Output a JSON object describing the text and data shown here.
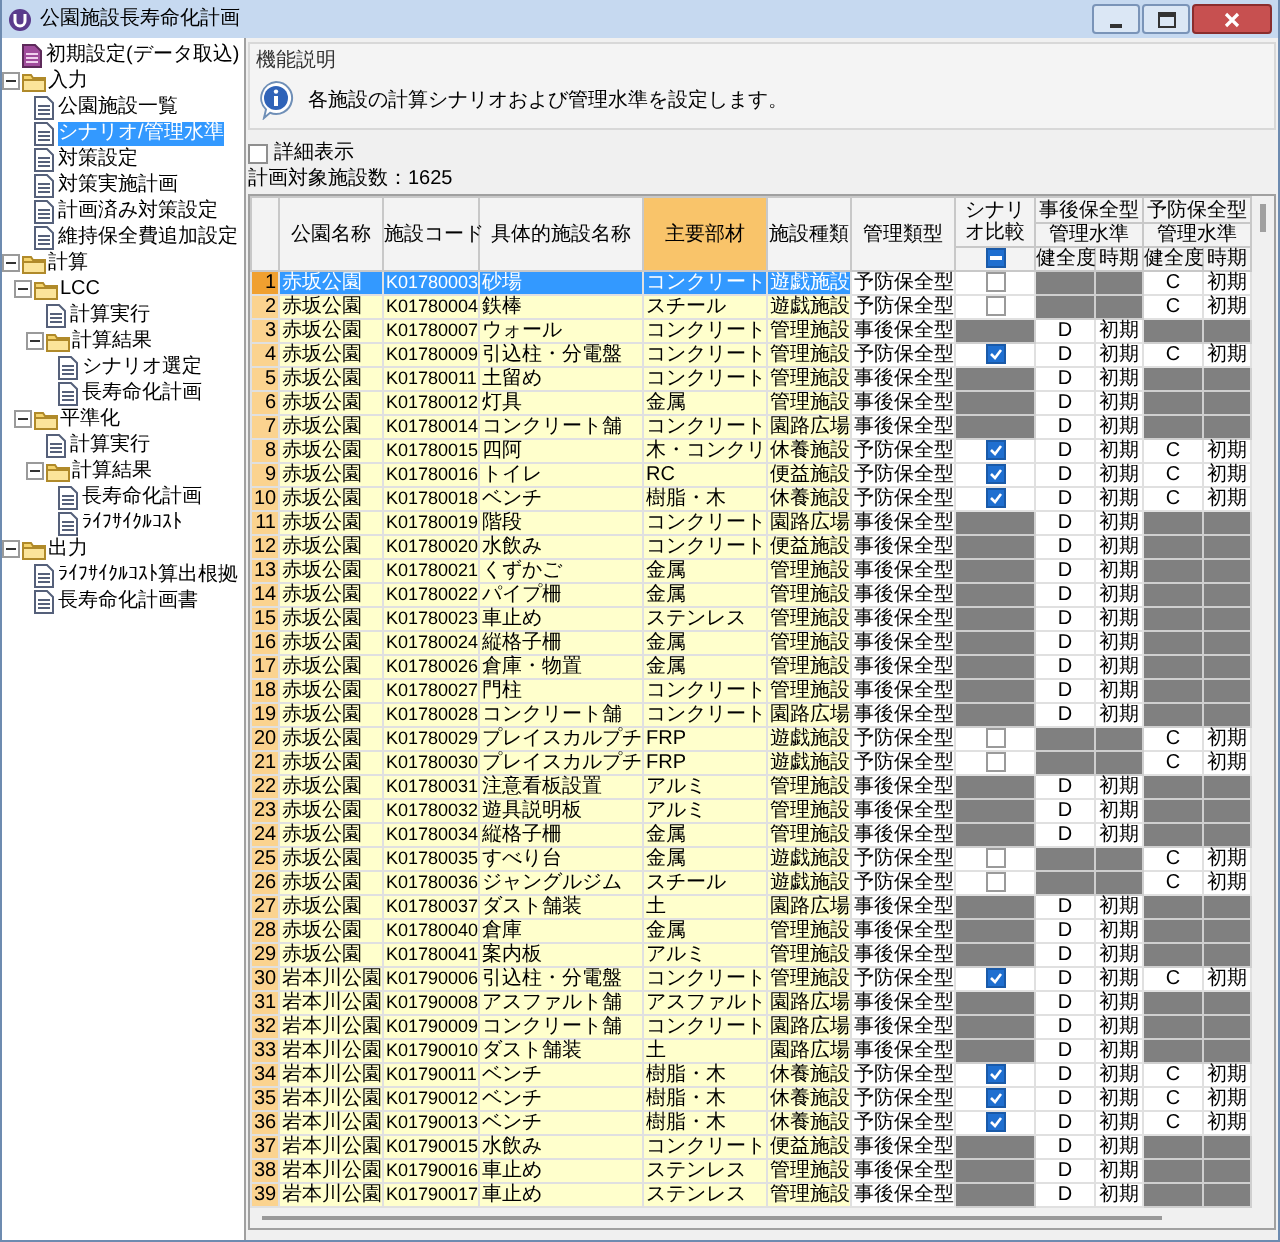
{
  "window": {
    "title": "公園施設長寿命化計画"
  },
  "sidebar": {
    "tree": [
      {
        "label": "初期設定(データ取込)",
        "kind": "special",
        "selected": false
      },
      {
        "label": "入力",
        "kind": "folder",
        "expanded": true,
        "selected": false,
        "children": [
          {
            "label": "公園施設一覧",
            "kind": "doc",
            "selected": false
          },
          {
            "label": "シナリオ/管理水準",
            "kind": "doc",
            "selected": true
          },
          {
            "label": "対策設定",
            "kind": "doc",
            "selected": false
          },
          {
            "label": "対策実施計画",
            "kind": "doc",
            "selected": false
          },
          {
            "label": "計画済み対策設定",
            "kind": "doc",
            "selected": false
          },
          {
            "label": "維持保全費追加設定",
            "kind": "doc",
            "selected": false
          }
        ]
      },
      {
        "label": "計算",
        "kind": "folder",
        "expanded": true,
        "selected": false,
        "children": [
          {
            "label": "LCC",
            "kind": "folder",
            "expanded": true,
            "selected": false,
            "children": [
              {
                "label": "計算実行",
                "kind": "doc",
                "selected": false
              },
              {
                "label": "計算結果",
                "kind": "folder",
                "expanded": true,
                "selected": false,
                "children": [
                  {
                    "label": "シナリオ選定",
                    "kind": "doc",
                    "selected": false
                  },
                  {
                    "label": "長寿命化計画",
                    "kind": "doc",
                    "selected": false
                  }
                ]
              }
            ]
          },
          {
            "label": "平準化",
            "kind": "folder",
            "expanded": true,
            "selected": false,
            "children": [
              {
                "label": "計算実行",
                "kind": "doc",
                "selected": false
              },
              {
                "label": "計算結果",
                "kind": "folder",
                "expanded": true,
                "selected": false,
                "children": [
                  {
                    "label": "長寿命化計画",
                    "kind": "doc",
                    "selected": false
                  },
                  {
                    "label": "ﾗｲﾌｻｲｸﾙｺｽﾄ",
                    "kind": "doc",
                    "selected": false
                  }
                ]
              }
            ]
          }
        ]
      },
      {
        "label": "出力",
        "kind": "folder",
        "expanded": true,
        "selected": false,
        "children": [
          {
            "label": "ﾗｲﾌｻｲｸﾙｺｽﾄ算出根拠",
            "kind": "doc",
            "selected": false
          },
          {
            "label": "長寿命化計画書",
            "kind": "doc",
            "selected": false
          }
        ]
      }
    ]
  },
  "description": {
    "label": "機能説明",
    "text": "各施設の計算シナリオおよび管理水準を設定します。"
  },
  "detail_checkbox": {
    "label": "詳細表示",
    "checked": false
  },
  "count": "計画対象施設数：1625",
  "table": {
    "columns": [
      {
        "label": "公園名称",
        "highlighted": false
      },
      {
        "label": "施設コード",
        "highlighted": false
      },
      {
        "label": "具体的施設名称",
        "highlighted": false
      },
      {
        "label": "主要部材",
        "highlighted": true
      },
      {
        "label": "施設種類",
        "highlighted": false
      },
      {
        "label": "管理類型",
        "highlighted": false
      },
      {
        "label": "シナリオ比較",
        "highlighted": false
      }
    ],
    "groups": [
      {
        "label": "事後保全型",
        "sub": "管理水準",
        "cols": [
          "健全度",
          "時期"
        ]
      },
      {
        "label": "予防保全型",
        "sub": "管理水準",
        "cols": [
          "健全度",
          "時期"
        ]
      }
    ],
    "compare_all": {
      "mixed": true
    },
    "rows": [
      {
        "no": "1",
        "park": "赤坂公園",
        "code": "K01780003",
        "name": "砂場",
        "material": "コンクリート",
        "type": "遊戯施設",
        "mgmt": "予防保全型",
        "selected": true,
        "compare": {
          "checked": false
        },
        "prev": {
          "health": "C",
          "timing": "初期"
        }
      },
      {
        "no": "2",
        "park": "赤坂公園",
        "code": "K01780004",
        "name": "鉄棒",
        "material": "スチール",
        "type": "遊戯施設",
        "mgmt": "予防保全型",
        "selected": false,
        "compare": {
          "checked": false
        },
        "prev": {
          "health": "C",
          "timing": "初期"
        }
      },
      {
        "no": "3",
        "park": "赤坂公園",
        "code": "K01780007",
        "name": "ウォール",
        "material": "コンクリート",
        "type": "管理施設",
        "mgmt": "事後保全型",
        "selected": false,
        "post": {
          "health": "D",
          "timing": "初期"
        }
      },
      {
        "no": "4",
        "park": "赤坂公園",
        "code": "K01780009",
        "name": "引込柱・分電盤",
        "material": "コンクリート",
        "type": "管理施設",
        "mgmt": "予防保全型",
        "selected": false,
        "compare": {
          "checked": true
        },
        "post": {
          "health": "D",
          "timing": "初期"
        },
        "prev": {
          "health": "C",
          "timing": "初期"
        }
      },
      {
        "no": "5",
        "park": "赤坂公園",
        "code": "K01780011",
        "name": "土留め",
        "material": "コンクリート",
        "type": "管理施設",
        "mgmt": "事後保全型",
        "selected": false,
        "post": {
          "health": "D",
          "timing": "初期"
        }
      },
      {
        "no": "6",
        "park": "赤坂公園",
        "code": "K01780012",
        "name": "灯具",
        "material": "金属",
        "type": "管理施設",
        "mgmt": "事後保全型",
        "selected": false,
        "post": {
          "health": "D",
          "timing": "初期"
        }
      },
      {
        "no": "7",
        "park": "赤坂公園",
        "code": "K01780014",
        "name": "コンクリート舗",
        "material": "コンクリート",
        "type": "園路広場",
        "mgmt": "事後保全型",
        "selected": false,
        "post": {
          "health": "D",
          "timing": "初期"
        }
      },
      {
        "no": "8",
        "park": "赤坂公園",
        "code": "K01780015",
        "name": "四阿",
        "material": "木・コンクリ",
        "type": "休養施設",
        "mgmt": "予防保全型",
        "selected": false,
        "compare": {
          "checked": true
        },
        "post": {
          "health": "D",
          "timing": "初期"
        },
        "prev": {
          "health": "C",
          "timing": "初期"
        }
      },
      {
        "no": "9",
        "park": "赤坂公園",
        "code": "K01780016",
        "name": "トイレ",
        "material": "RC",
        "type": "便益施設",
        "mgmt": "予防保全型",
        "selected": false,
        "compare": {
          "checked": true
        },
        "post": {
          "health": "D",
          "timing": "初期"
        },
        "prev": {
          "health": "C",
          "timing": "初期"
        }
      },
      {
        "no": "10",
        "park": "赤坂公園",
        "code": "K01780018",
        "name": "ベンチ",
        "material": "樹脂・木",
        "type": "休養施設",
        "mgmt": "予防保全型",
        "selected": false,
        "compare": {
          "checked": true
        },
        "post": {
          "health": "D",
          "timing": "初期"
        },
        "prev": {
          "health": "C",
          "timing": "初期"
        }
      },
      {
        "no": "11",
        "park": "赤坂公園",
        "code": "K01780019",
        "name": "階段",
        "material": "コンクリート",
        "type": "園路広場",
        "mgmt": "事後保全型",
        "selected": false,
        "post": {
          "health": "D",
          "timing": "初期"
        }
      },
      {
        "no": "12",
        "park": "赤坂公園",
        "code": "K01780020",
        "name": "水飲み",
        "material": "コンクリート",
        "type": "便益施設",
        "mgmt": "事後保全型",
        "selected": false,
        "post": {
          "health": "D",
          "timing": "初期"
        }
      },
      {
        "no": "13",
        "park": "赤坂公園",
        "code": "K01780021",
        "name": "くずかご",
        "material": "金属",
        "type": "管理施設",
        "mgmt": "事後保全型",
        "selected": false,
        "post": {
          "health": "D",
          "timing": "初期"
        }
      },
      {
        "no": "14",
        "park": "赤坂公園",
        "code": "K01780022",
        "name": "パイプ柵",
        "material": "金属",
        "type": "管理施設",
        "mgmt": "事後保全型",
        "selected": false,
        "post": {
          "health": "D",
          "timing": "初期"
        }
      },
      {
        "no": "15",
        "park": "赤坂公園",
        "code": "K01780023",
        "name": "車止め",
        "material": "ステンレス",
        "type": "管理施設",
        "mgmt": "事後保全型",
        "selected": false,
        "post": {
          "health": "D",
          "timing": "初期"
        }
      },
      {
        "no": "16",
        "park": "赤坂公園",
        "code": "K01780024",
        "name": "縦格子柵",
        "material": "金属",
        "type": "管理施設",
        "mgmt": "事後保全型",
        "selected": false,
        "post": {
          "health": "D",
          "timing": "初期"
        }
      },
      {
        "no": "17",
        "park": "赤坂公園",
        "code": "K01780026",
        "name": "倉庫・物置",
        "material": "金属",
        "type": "管理施設",
        "mgmt": "事後保全型",
        "selected": false,
        "post": {
          "health": "D",
          "timing": "初期"
        }
      },
      {
        "no": "18",
        "park": "赤坂公園",
        "code": "K01780027",
        "name": "門柱",
        "material": "コンクリート",
        "type": "管理施設",
        "mgmt": "事後保全型",
        "selected": false,
        "post": {
          "health": "D",
          "timing": "初期"
        }
      },
      {
        "no": "19",
        "park": "赤坂公園",
        "code": "K01780028",
        "name": "コンクリート舗",
        "material": "コンクリート",
        "type": "園路広場",
        "mgmt": "事後保全型",
        "selected": false,
        "post": {
          "health": "D",
          "timing": "初期"
        }
      },
      {
        "no": "20",
        "park": "赤坂公園",
        "code": "K01780029",
        "name": "プレイスカルプチ",
        "material": "FRP",
        "type": "遊戯施設",
        "mgmt": "予防保全型",
        "selected": false,
        "compare": {
          "checked": false
        },
        "prev": {
          "health": "C",
          "timing": "初期"
        }
      },
      {
        "no": "21",
        "park": "赤坂公園",
        "code": "K01780030",
        "name": "プレイスカルプチ",
        "material": "FRP",
        "type": "遊戯施設",
        "mgmt": "予防保全型",
        "selected": false,
        "compare": {
          "checked": false
        },
        "prev": {
          "health": "C",
          "timing": "初期"
        }
      },
      {
        "no": "22",
        "park": "赤坂公園",
        "code": "K01780031",
        "name": "注意看板設置",
        "material": "アルミ",
        "type": "管理施設",
        "mgmt": "事後保全型",
        "selected": false,
        "post": {
          "health": "D",
          "timing": "初期"
        }
      },
      {
        "no": "23",
        "park": "赤坂公園",
        "code": "K01780032",
        "name": "遊具説明板",
        "material": "アルミ",
        "type": "管理施設",
        "mgmt": "事後保全型",
        "selected": false,
        "post": {
          "health": "D",
          "timing": "初期"
        }
      },
      {
        "no": "24",
        "park": "赤坂公園",
        "code": "K01780034",
        "name": "縦格子柵",
        "material": "金属",
        "type": "管理施設",
        "mgmt": "事後保全型",
        "selected": false,
        "post": {
          "health": "D",
          "timing": "初期"
        }
      },
      {
        "no": "25",
        "park": "赤坂公園",
        "code": "K01780035",
        "name": "すべり台",
        "material": "金属",
        "type": "遊戯施設",
        "mgmt": "予防保全型",
        "selected": false,
        "compare": {
          "checked": false
        },
        "prev": {
          "health": "C",
          "timing": "初期"
        }
      },
      {
        "no": "26",
        "park": "赤坂公園",
        "code": "K01780036",
        "name": "ジャングルジム",
        "material": "スチール",
        "type": "遊戯施設",
        "mgmt": "予防保全型",
        "selected": false,
        "compare": {
          "checked": false
        },
        "prev": {
          "health": "C",
          "timing": "初期"
        }
      },
      {
        "no": "27",
        "park": "赤坂公園",
        "code": "K01780037",
        "name": "ダスト舗装",
        "material": "土",
        "type": "園路広場",
        "mgmt": "事後保全型",
        "selected": false,
        "post": {
          "health": "D",
          "timing": "初期"
        }
      },
      {
        "no": "28",
        "park": "赤坂公園",
        "code": "K01780040",
        "name": "倉庫",
        "material": "金属",
        "type": "管理施設",
        "mgmt": "事後保全型",
        "selected": false,
        "post": {
          "health": "D",
          "timing": "初期"
        }
      },
      {
        "no": "29",
        "park": "赤坂公園",
        "code": "K01780041",
        "name": "案内板",
        "material": "アルミ",
        "type": "管理施設",
        "mgmt": "事後保全型",
        "selected": false,
        "post": {
          "health": "D",
          "timing": "初期"
        }
      },
      {
        "no": "30",
        "park": "岩本川公園",
        "code": "K01790006",
        "name": "引込柱・分電盤",
        "material": "コンクリート",
        "type": "管理施設",
        "mgmt": "予防保全型",
        "selected": false,
        "compare": {
          "checked": true
        },
        "post": {
          "health": "D",
          "timing": "初期"
        },
        "prev": {
          "health": "C",
          "timing": "初期"
        }
      },
      {
        "no": "31",
        "park": "岩本川公園",
        "code": "K01790008",
        "name": "アスファルト舗",
        "material": "アスファルト",
        "type": "園路広場",
        "mgmt": "事後保全型",
        "selected": false,
        "post": {
          "health": "D",
          "timing": "初期"
        }
      },
      {
        "no": "32",
        "park": "岩本川公園",
        "code": "K01790009",
        "name": "コンクリート舗",
        "material": "コンクリート",
        "type": "園路広場",
        "mgmt": "事後保全型",
        "selected": false,
        "post": {
          "health": "D",
          "timing": "初期"
        }
      },
      {
        "no": "33",
        "park": "岩本川公園",
        "code": "K01790010",
        "name": "ダスト舗装",
        "material": "土",
        "type": "園路広場",
        "mgmt": "事後保全型",
        "selected": false,
        "post": {
          "health": "D",
          "timing": "初期"
        }
      },
      {
        "no": "34",
        "park": "岩本川公園",
        "code": "K01790011",
        "name": "ベンチ",
        "material": "樹脂・木",
        "type": "休養施設",
        "mgmt": "予防保全型",
        "selected": false,
        "compare": {
          "checked": true
        },
        "post": {
          "health": "D",
          "timing": "初期"
        },
        "prev": {
          "health": "C",
          "timing": "初期"
        }
      },
      {
        "no": "35",
        "park": "岩本川公園",
        "code": "K01790012",
        "name": "ベンチ",
        "material": "樹脂・木",
        "type": "休養施設",
        "mgmt": "予防保全型",
        "selected": false,
        "compare": {
          "checked": true
        },
        "post": {
          "health": "D",
          "timing": "初期"
        },
        "prev": {
          "health": "C",
          "timing": "初期"
        }
      },
      {
        "no": "36",
        "park": "岩本川公園",
        "code": "K01790013",
        "name": "ベンチ",
        "material": "樹脂・木",
        "type": "休養施設",
        "mgmt": "予防保全型",
        "selected": false,
        "compare": {
          "checked": true
        },
        "post": {
          "health": "D",
          "timing": "初期"
        },
        "prev": {
          "health": "C",
          "timing": "初期"
        }
      },
      {
        "no": "37",
        "park": "岩本川公園",
        "code": "K01790015",
        "name": "水飲み",
        "material": "コンクリート",
        "type": "便益施設",
        "mgmt": "事後保全型",
        "selected": false,
        "post": {
          "health": "D",
          "timing": "初期"
        }
      },
      {
        "no": "38",
        "park": "岩本川公園",
        "code": "K01790016",
        "name": "車止め",
        "material": "ステンレス",
        "type": "管理施設",
        "mgmt": "事後保全型",
        "selected": false,
        "post": {
          "health": "D",
          "timing": "初期"
        }
      },
      {
        "no": "39",
        "park": "岩本川公園",
        "code": "K01790017",
        "name": "車止め",
        "material": "ステンレス",
        "type": "管理施設",
        "mgmt": "事後保全型",
        "selected": false,
        "post": {
          "health": "D",
          "timing": "初期"
        }
      }
    ]
  }
}
